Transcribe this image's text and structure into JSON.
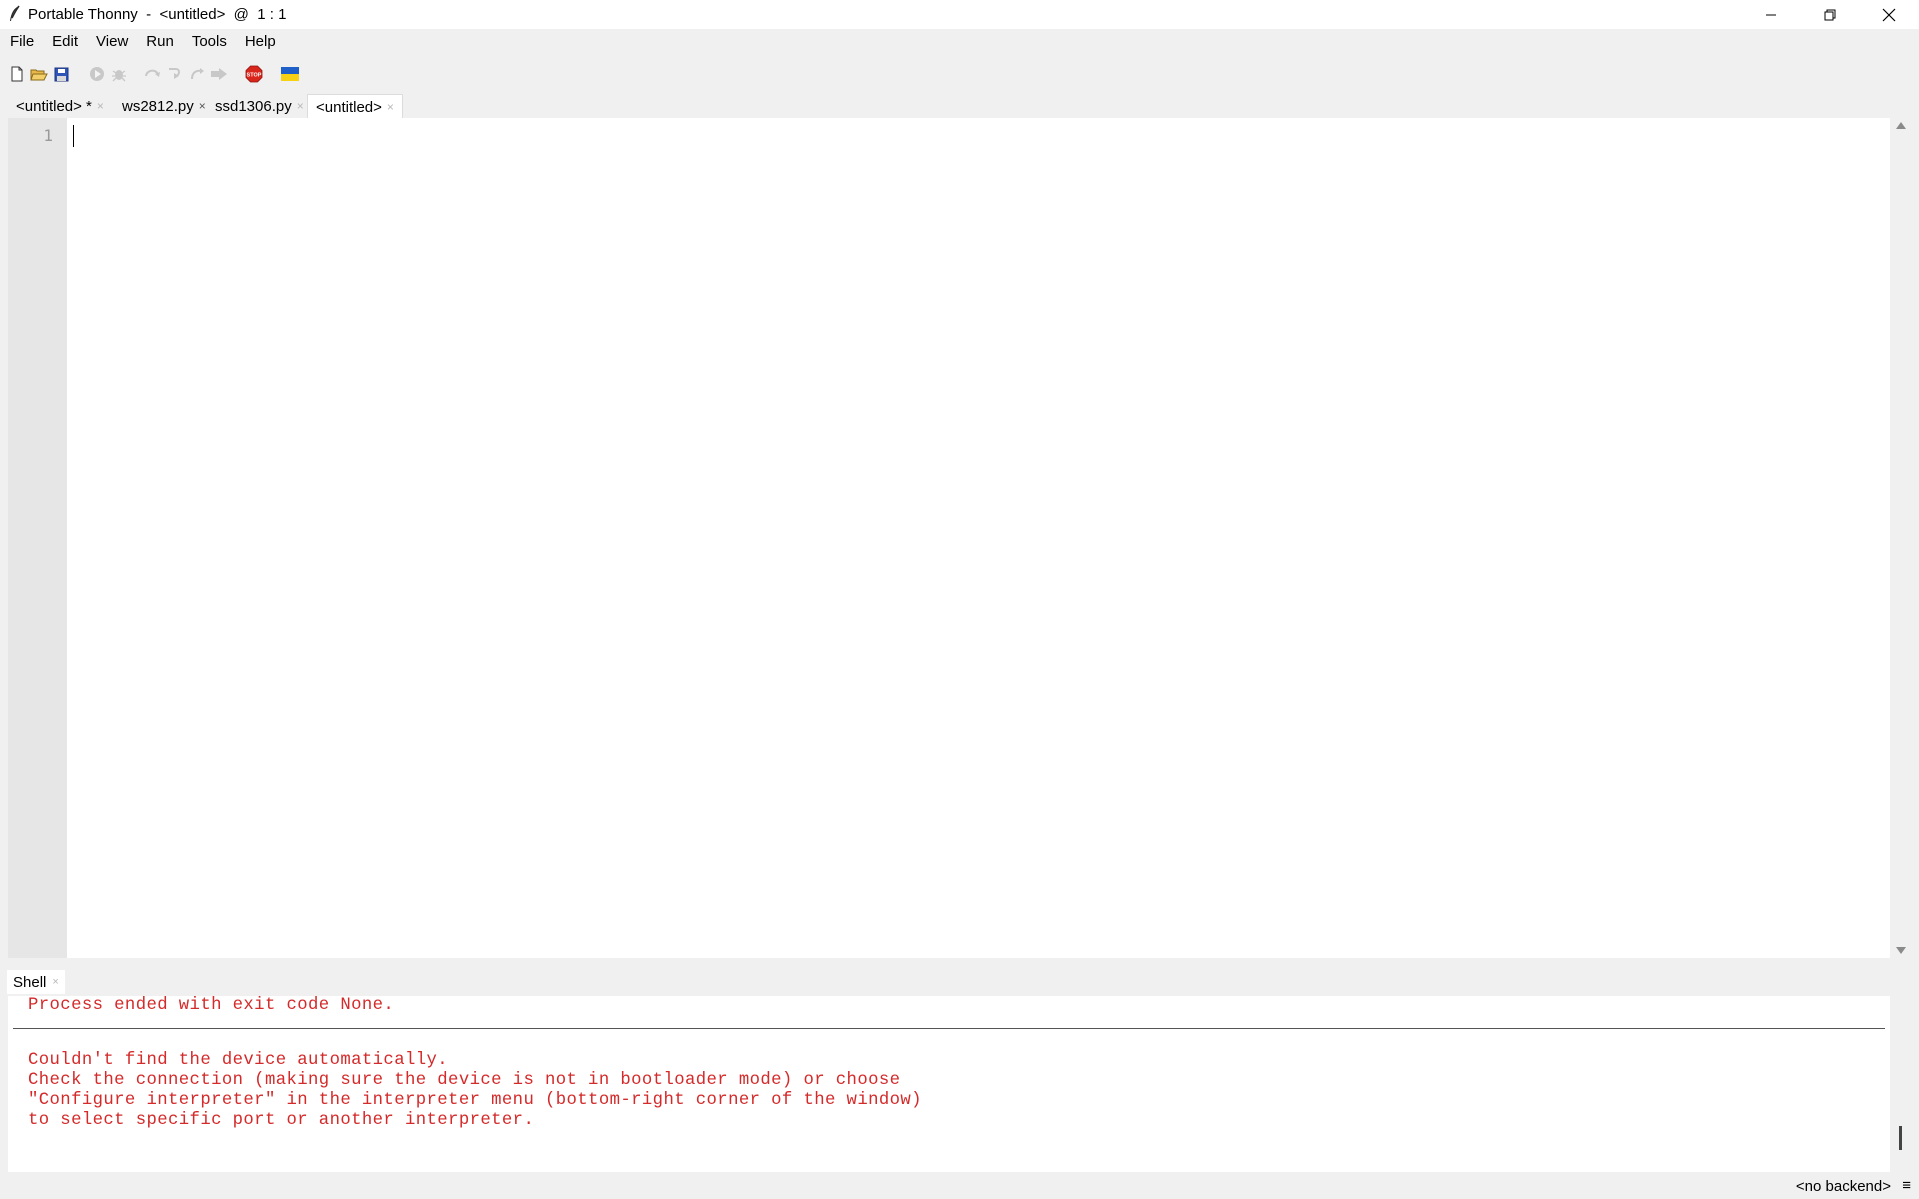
{
  "window": {
    "title": "Portable Thonny  -  <untitled>  @  1 : 1",
    "minimize_glyph": "—",
    "close_glyph": "✕"
  },
  "menu": [
    "File",
    "Edit",
    "View",
    "Run",
    "Tools",
    "Help"
  ],
  "toolbar": {
    "buttons": [
      {
        "icon": "new-file-icon",
        "enabled": true
      },
      {
        "icon": "open-folder-icon",
        "enabled": true
      },
      {
        "icon": "save-icon",
        "enabled": true
      },
      {
        "icon": "run-icon",
        "enabled": false
      },
      {
        "icon": "debug-icon",
        "enabled": false
      },
      {
        "icon": "step-over-icon",
        "enabled": false
      },
      {
        "icon": "step-into-icon",
        "enabled": false
      },
      {
        "icon": "step-out-icon",
        "enabled": false
      },
      {
        "icon": "resume-icon",
        "enabled": false
      },
      {
        "icon": "stop-icon",
        "enabled": true,
        "label": "STOP",
        "color": "#d9261c"
      },
      {
        "icon": "ukraine-flag-icon",
        "enabled": true,
        "colors": [
          "#1f5fc8",
          "#f7d214"
        ]
      }
    ]
  },
  "editor_tabs": [
    {
      "label": "<untitled> *",
      "close": "×",
      "active": false
    },
    {
      "label": "ws2812.py",
      "close": "×",
      "active": false
    },
    {
      "label": "ssd1306.py",
      "close": "×",
      "active": false
    },
    {
      "label": "<untitled>",
      "close": "×",
      "active": true
    }
  ],
  "editor": {
    "line_numbers": [
      "1"
    ],
    "content": ""
  },
  "shell": {
    "tab_label": "Shell",
    "tab_close": "×",
    "lines": [
      "Process ended with exit code None.",
      "Couldn't find the device automatically.",
      "Check the connection (making sure the device is not in bootloader mode) or choose",
      "\"Configure interpreter\" in the interpreter menu (bottom-right corner of the window)",
      "to select specific port or another interpreter."
    ],
    "text_color": "#d42a2a"
  },
  "statusbar": {
    "backend": "<no backend>",
    "menu_glyph": "≡"
  }
}
